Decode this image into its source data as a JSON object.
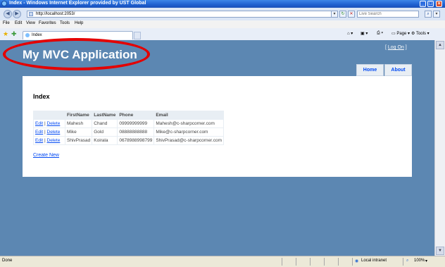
{
  "window": {
    "title": "Index - Windows Internet Explorer provided by UST Global"
  },
  "address_bar": {
    "url": "http://localhost:2053/",
    "search_placeholder": "Live Search"
  },
  "menu": [
    "File",
    "Edit",
    "View",
    "Favorites",
    "Tools",
    "Help"
  ],
  "tab": {
    "title": "Index"
  },
  "toolbar": {
    "page_label": "Page",
    "tools_label": "Tools"
  },
  "app": {
    "title": "My MVC Application",
    "login_prefix": "[ ",
    "login_link": "Log On",
    "login_suffix": " ]",
    "nav": [
      "Home",
      "About"
    ]
  },
  "content": {
    "heading": "Index",
    "columns": [
      "",
      "FirstName",
      "LastName",
      "Phone",
      "Email"
    ],
    "rows": [
      {
        "edit": "Edit",
        "sep": " | ",
        "delete": "Delete",
        "first": "Mahesh",
        "last": "Chand",
        "phone": "09999999999",
        "email": "Mahesh@c-sharpcorner.com"
      },
      {
        "edit": "Edit",
        "sep": " | ",
        "delete": "Delete",
        "first": "Mike",
        "last": "Gold",
        "phone": "08888888888",
        "email": "Mike@c-sharpcorner.com"
      },
      {
        "edit": "Edit",
        "sep": " | ",
        "delete": "Delete",
        "first": "ShivPrasad",
        "last": "Koirala",
        "phone": "0678988998799",
        "email": "ShivPrasad@c-sharpcorner.com"
      }
    ],
    "create_new": "Create New"
  },
  "status_bar": {
    "left": "Done",
    "zone": "Local intranet",
    "zoom": "100%"
  },
  "colors": {
    "page_bg": "#5c87b2",
    "link": "#034af3",
    "highlight_ellipse": "#e40000"
  }
}
